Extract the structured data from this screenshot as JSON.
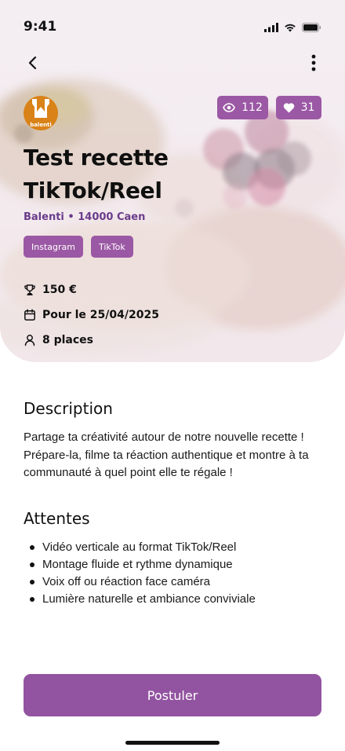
{
  "status_bar": {
    "time": "9:41"
  },
  "nav": {
    "back_icon": "chevron-left-icon",
    "more_icon": "more-vertical-icon"
  },
  "brand": {
    "logo_text": "balenti"
  },
  "stats": {
    "views": "112",
    "likes": "31"
  },
  "campaign": {
    "title_line1": "Test recette",
    "title_line2": "TikTok/Reel",
    "meta": "Balenti • 14000 Caen",
    "tags": [
      "Instagram",
      "TikTok"
    ],
    "reward": "150 €",
    "date": "Pour le 25/04/2025",
    "places": "8 places"
  },
  "description": {
    "title": "Description",
    "text": "Partage ta créativité autour de notre nouvelle recette ! Prépare-la, filme ta réaction authentique et montre à ta communauté à quel point elle te régale !"
  },
  "expectations": {
    "title": "Attentes",
    "items": [
      "Vidéo verticale au format TikTok/Reel",
      "Montage fluide et rythme dynamique",
      "Voix off ou réaction face caméra",
      "Lumière naturelle et ambiance conviviale"
    ]
  },
  "cta": {
    "label": "Postuler"
  },
  "colors": {
    "accent": "#9b58a4",
    "accent_dark": "#6a3c8b",
    "brand_orange": "#d98217"
  }
}
